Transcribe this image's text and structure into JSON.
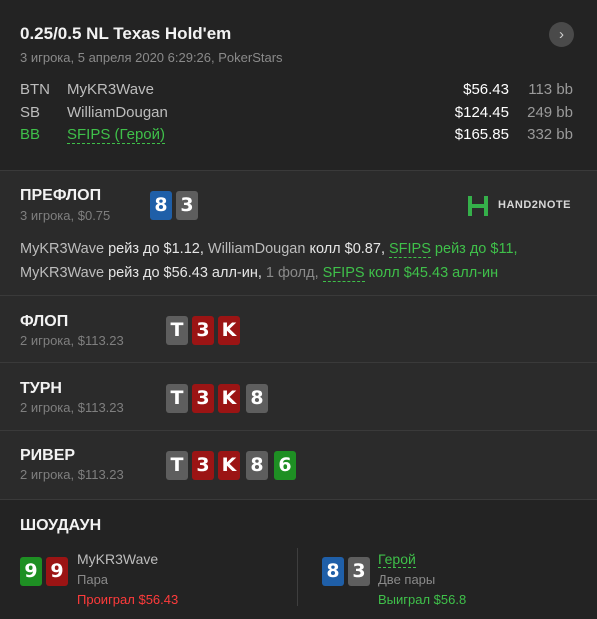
{
  "header": {
    "title": "0.25/0.5 NL Texas Hold'em",
    "subtitle": "3 игрока, 5 апреля 2020 6:29:26, PokerStars",
    "next_icon": "chevron-right-icon",
    "next_glyph": "›"
  },
  "players": [
    {
      "position": "BTN",
      "name": "MyKR3Wave",
      "stack": "$56.43",
      "bb": "113 bb",
      "hero": false
    },
    {
      "position": "SB",
      "name": "WilliamDougan",
      "stack": "$124.45",
      "bb": "249 bb",
      "hero": false
    },
    {
      "position": "BB",
      "name": "SFIPS (Герой)",
      "stack": "$165.85",
      "bb": "332 bb",
      "hero": true
    }
  ],
  "preflop": {
    "title": "ПРЕФЛОП",
    "sub": "3 игрока, $0.75",
    "cards": [
      "8",
      "3"
    ],
    "logo_text": "HAND2NOTE",
    "actions_line1": {
      "p1": "MyKR3Wave",
      "a1": " рейз до $1.12, ",
      "p2": "WilliamDougan",
      "a2": " колл $0.87, ",
      "p3": "SFIPS",
      "a3": " рейз до $11,"
    },
    "actions_line2": {
      "p1": "MyKR3Wave",
      "a1": " рейз до $56.43 алл-ин, ",
      "fold": "1 фолд, ",
      "p2": "SFIPS",
      "a2": " колл $45.43 алл-ин"
    }
  },
  "streets": [
    {
      "title": "ФЛОП",
      "sub": "2 игрока, $113.23",
      "cards": [
        "T",
        "3",
        "K"
      ]
    },
    {
      "title": "ТУРН",
      "sub": "2 игрока, $113.23",
      "cards": [
        "T",
        "3",
        "K",
        "8"
      ]
    },
    {
      "title": "РИВЕР",
      "sub": "2 игрока, $113.23",
      "cards": [
        "T",
        "3",
        "K",
        "8",
        "6"
      ]
    }
  ],
  "showdown": {
    "title": "ШОУДАУН",
    "left": {
      "cards": [
        "9",
        "9"
      ],
      "name": "MyKR3Wave",
      "hand": "Пара",
      "result": "Проиграл $56.43"
    },
    "right": {
      "cards": [
        "8",
        "3"
      ],
      "name": "Герой",
      "hand": "Две пары",
      "result": "Выиграл $56.8"
    }
  },
  "colors": {
    "hero_green": "#3fc04a",
    "loss_red": "#ff3b3b",
    "card_blue": "#1f5fa8",
    "card_gray": "#5e5e5e",
    "card_red": "#9b1414",
    "card_green": "#1e8f23"
  }
}
